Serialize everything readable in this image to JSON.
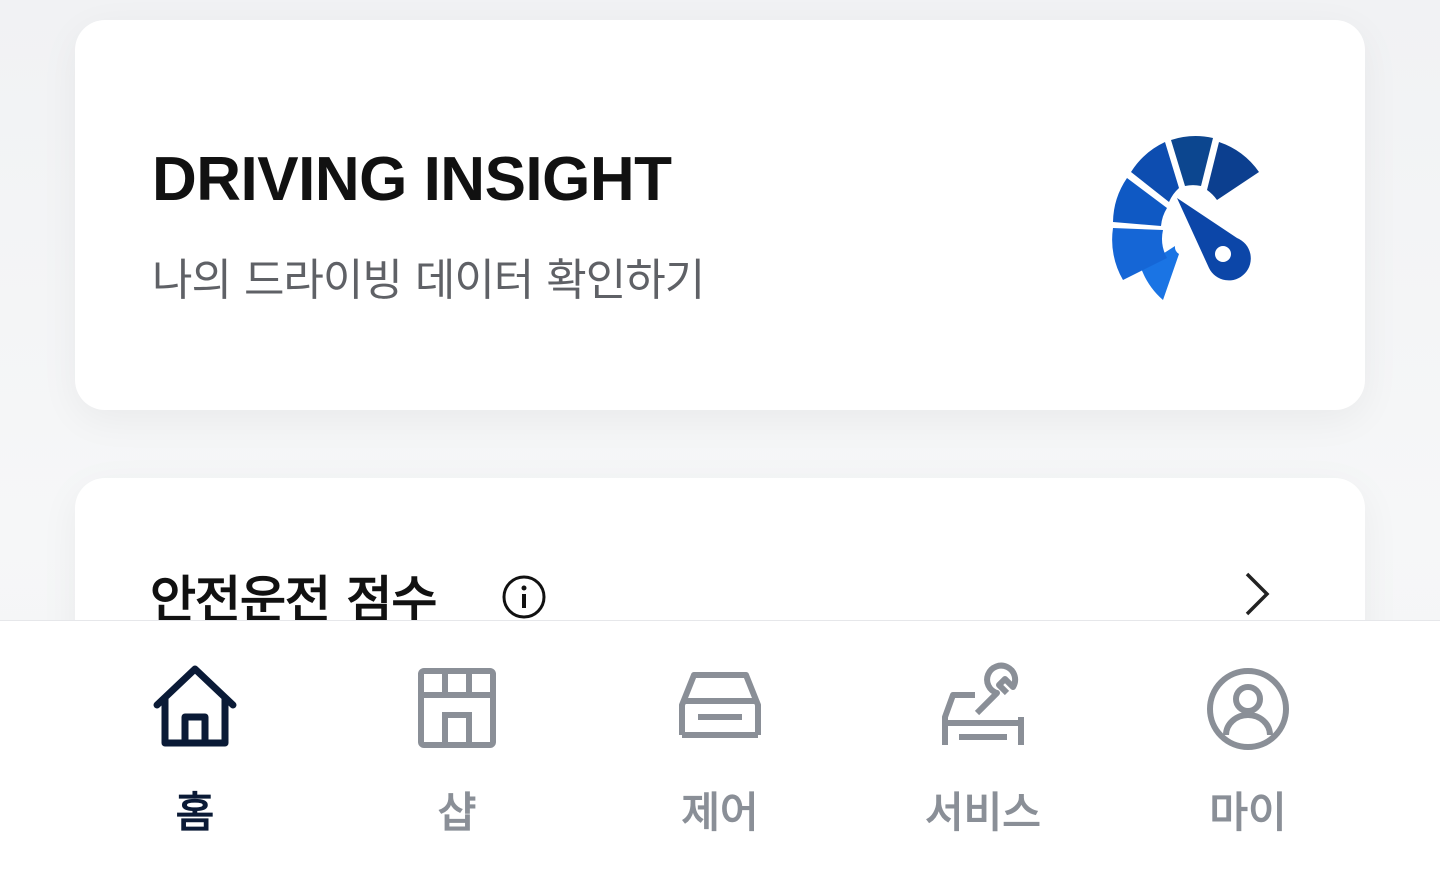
{
  "insight_card": {
    "title": "DRIVING INSIGHT",
    "subtitle": "나의 드라이빙 데이터 확인하기",
    "icon": "speedometer-gauge-icon"
  },
  "safety_card": {
    "title": "안전운전 점수",
    "info_icon": "info-icon",
    "chevron_icon": "chevron-right-icon"
  },
  "tabbar": {
    "active_color": "#0a1a36",
    "inactive_color": "#8a8f97",
    "tabs": [
      {
        "label": "홈",
        "icon": "home-icon",
        "active": true
      },
      {
        "label": "샵",
        "icon": "shop-icon",
        "active": false
      },
      {
        "label": "제어",
        "icon": "car-icon",
        "active": false
      },
      {
        "label": "서비스",
        "icon": "car-wrench-icon",
        "active": false
      },
      {
        "label": "마이",
        "icon": "user-icon",
        "active": false
      }
    ]
  },
  "colors": {
    "gauge_dark": "#0c3f8f",
    "gauge_mid": "#0f59c4",
    "gauge_light": "#1a74e4"
  }
}
